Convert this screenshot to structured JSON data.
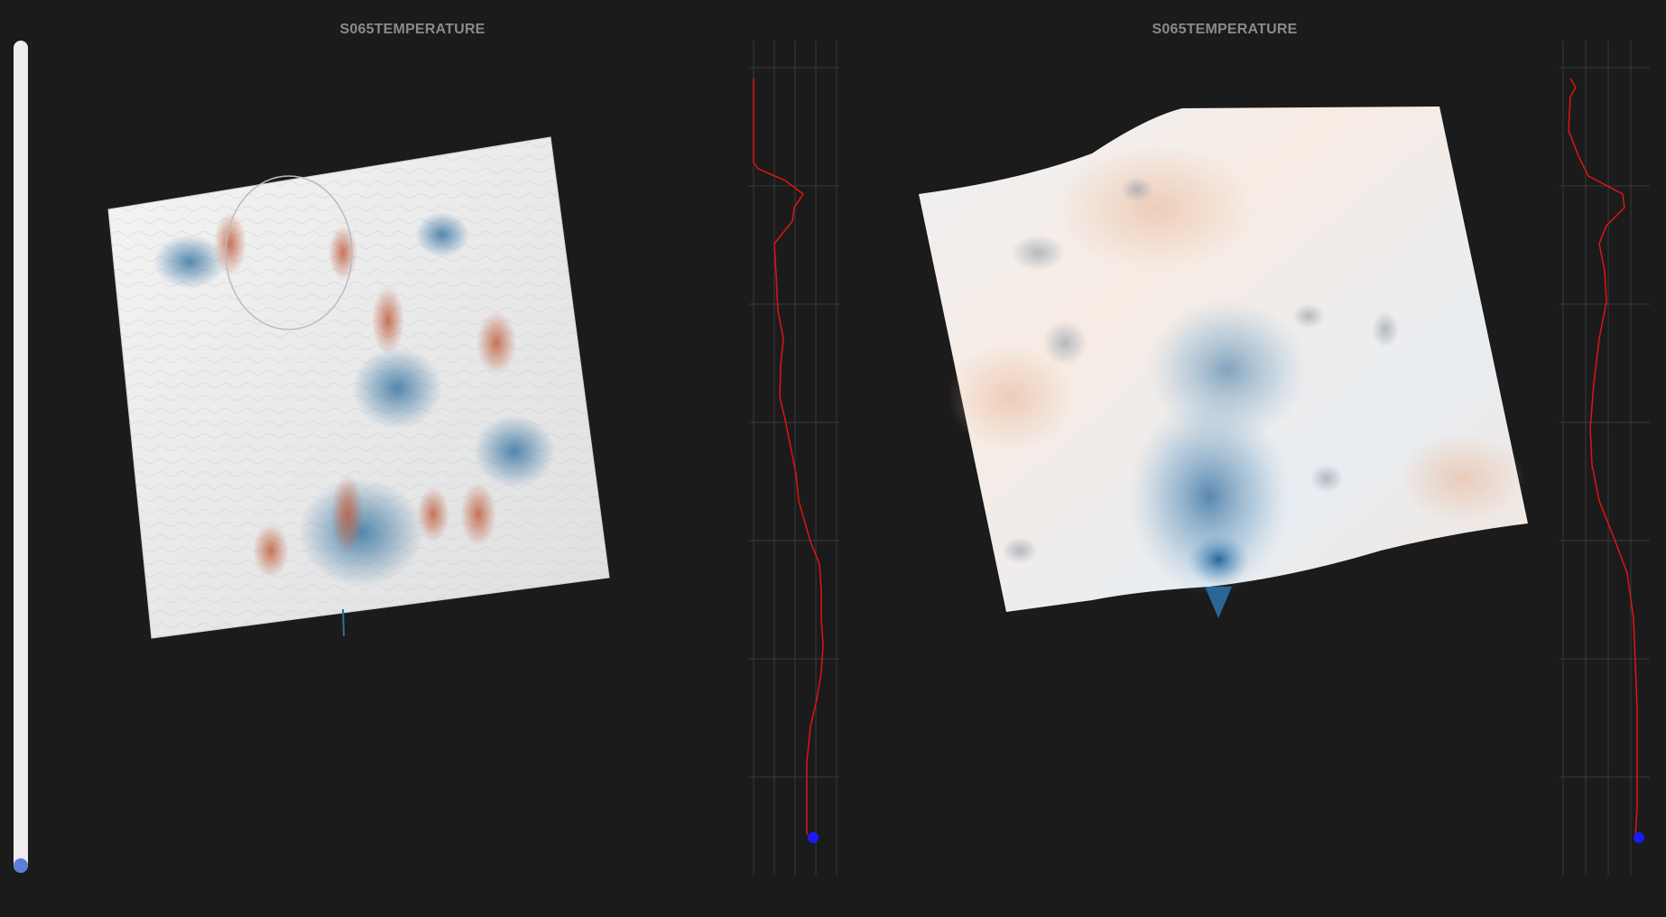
{
  "panels": [
    {
      "title": "S065TEMPERATURE"
    },
    {
      "title": "S065TEMPERATURE"
    }
  ],
  "slider": {
    "level": 1.0
  },
  "colors": {
    "background": "#1b1b1b",
    "profile_line": "#e01414",
    "profile_marker": "#1a1aff",
    "slider_track": "#eeeeee",
    "slider_thumb": "#5b7fd6",
    "surface_warm": "#c0603f",
    "surface_cool": "#2e6f9e",
    "surface_neutral": "#f2f2f2"
  }
}
